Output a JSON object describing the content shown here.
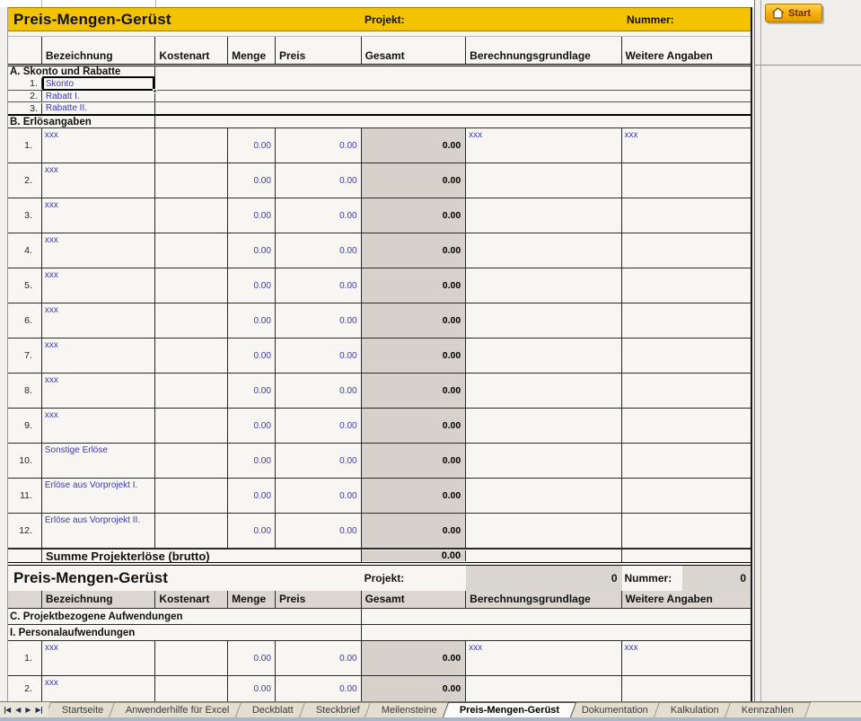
{
  "app": {
    "start_label": "Start"
  },
  "header1": {
    "title": "Preis-Mengen-Gerüst",
    "projekt_label": "Projekt:",
    "nummer_label": "Nummer:"
  },
  "columns": [
    "",
    "Bezeichnung",
    "Kostenart",
    "Menge",
    "Preis",
    "Gesamt",
    "Berechnungsgrundlage",
    "Weitere Angaben"
  ],
  "section_a": {
    "title": "A.  Skonto und Rabatte",
    "rows": [
      {
        "num": "1.",
        "label": "Skonto",
        "cls": "sel"
      },
      {
        "num": "2.",
        "label": "Rabatt I."
      },
      {
        "num": "3.",
        "label": "Rabatte II."
      }
    ]
  },
  "section_b": {
    "title": "B.  Erlösangaben",
    "rows": [
      {
        "num": "1.",
        "label": "xxx",
        "menge": "0.00",
        "preis": "0.00",
        "gesamt": "0.00",
        "ber": "xxx",
        "wei": "xxx"
      },
      {
        "num": "2.",
        "label": "xxx",
        "menge": "0.00",
        "preis": "0.00",
        "gesamt": "0.00"
      },
      {
        "num": "3.",
        "label": "xxx",
        "menge": "0.00",
        "preis": "0.00",
        "gesamt": "0.00"
      },
      {
        "num": "4.",
        "label": "xxx",
        "menge": "0.00",
        "preis": "0.00",
        "gesamt": "0.00"
      },
      {
        "num": "5.",
        "label": "xxx",
        "menge": "0.00",
        "preis": "0.00",
        "gesamt": "0.00"
      },
      {
        "num": "6.",
        "label": "xxx",
        "menge": "0.00",
        "preis": "0.00",
        "gesamt": "0.00"
      },
      {
        "num": "7.",
        "label": "xxx",
        "menge": "0.00",
        "preis": "0.00",
        "gesamt": "0.00"
      },
      {
        "num": "8.",
        "label": "xxx",
        "menge": "0.00",
        "preis": "0.00",
        "gesamt": "0.00"
      },
      {
        "num": "9.",
        "label": "xxx",
        "menge": "0.00",
        "preis": "0.00",
        "gesamt": "0.00"
      },
      {
        "num": "10.",
        "label": "Sonstige Erlöse",
        "menge": "0.00",
        "preis": "0.00",
        "gesamt": "0.00"
      },
      {
        "num": "11.",
        "label": "Erlöse aus Vorprojekt I.",
        "menge": "0.00",
        "preis": "0.00",
        "gesamt": "0.00"
      },
      {
        "num": "12.",
        "label": "Erlöse aus Vorprojekt II.",
        "menge": "0.00",
        "preis": "0.00",
        "gesamt": "0.00"
      }
    ]
  },
  "summe": {
    "label": "Summe Projekterlöse (brutto)",
    "value": "0.00"
  },
  "header2": {
    "title": "Preis-Mengen-Gerüst",
    "projekt_label": "Projekt:",
    "projekt_value": "0",
    "nummer_label": "Nummer:",
    "nummer_value": "0"
  },
  "section_c": {
    "title": "C.  Projektbezogene Aufwendungen"
  },
  "section_i": {
    "title": "I.  Personalaufwendungen",
    "rows": [
      {
        "num": "1.",
        "label": "xxx",
        "menge": "0.00",
        "preis": "0.00",
        "gesamt": "0.00",
        "ber": "xxx",
        "wei": "xxx"
      },
      {
        "num": "2.",
        "label": "xxx",
        "menge": "0.00",
        "preis": "0.00",
        "gesamt": "0.00",
        "cls": "cut"
      }
    ]
  },
  "tabs": {
    "items": [
      "Startseite",
      "Anwenderhilfe für Excel",
      "Deckblatt",
      "Steckbrief",
      "Meilensteine",
      "Preis-Mengen-Gerüst",
      "Dokumentation",
      "Kalkulation",
      "Kennzahlen"
    ],
    "active": "Preis-Mengen-Gerüst"
  }
}
